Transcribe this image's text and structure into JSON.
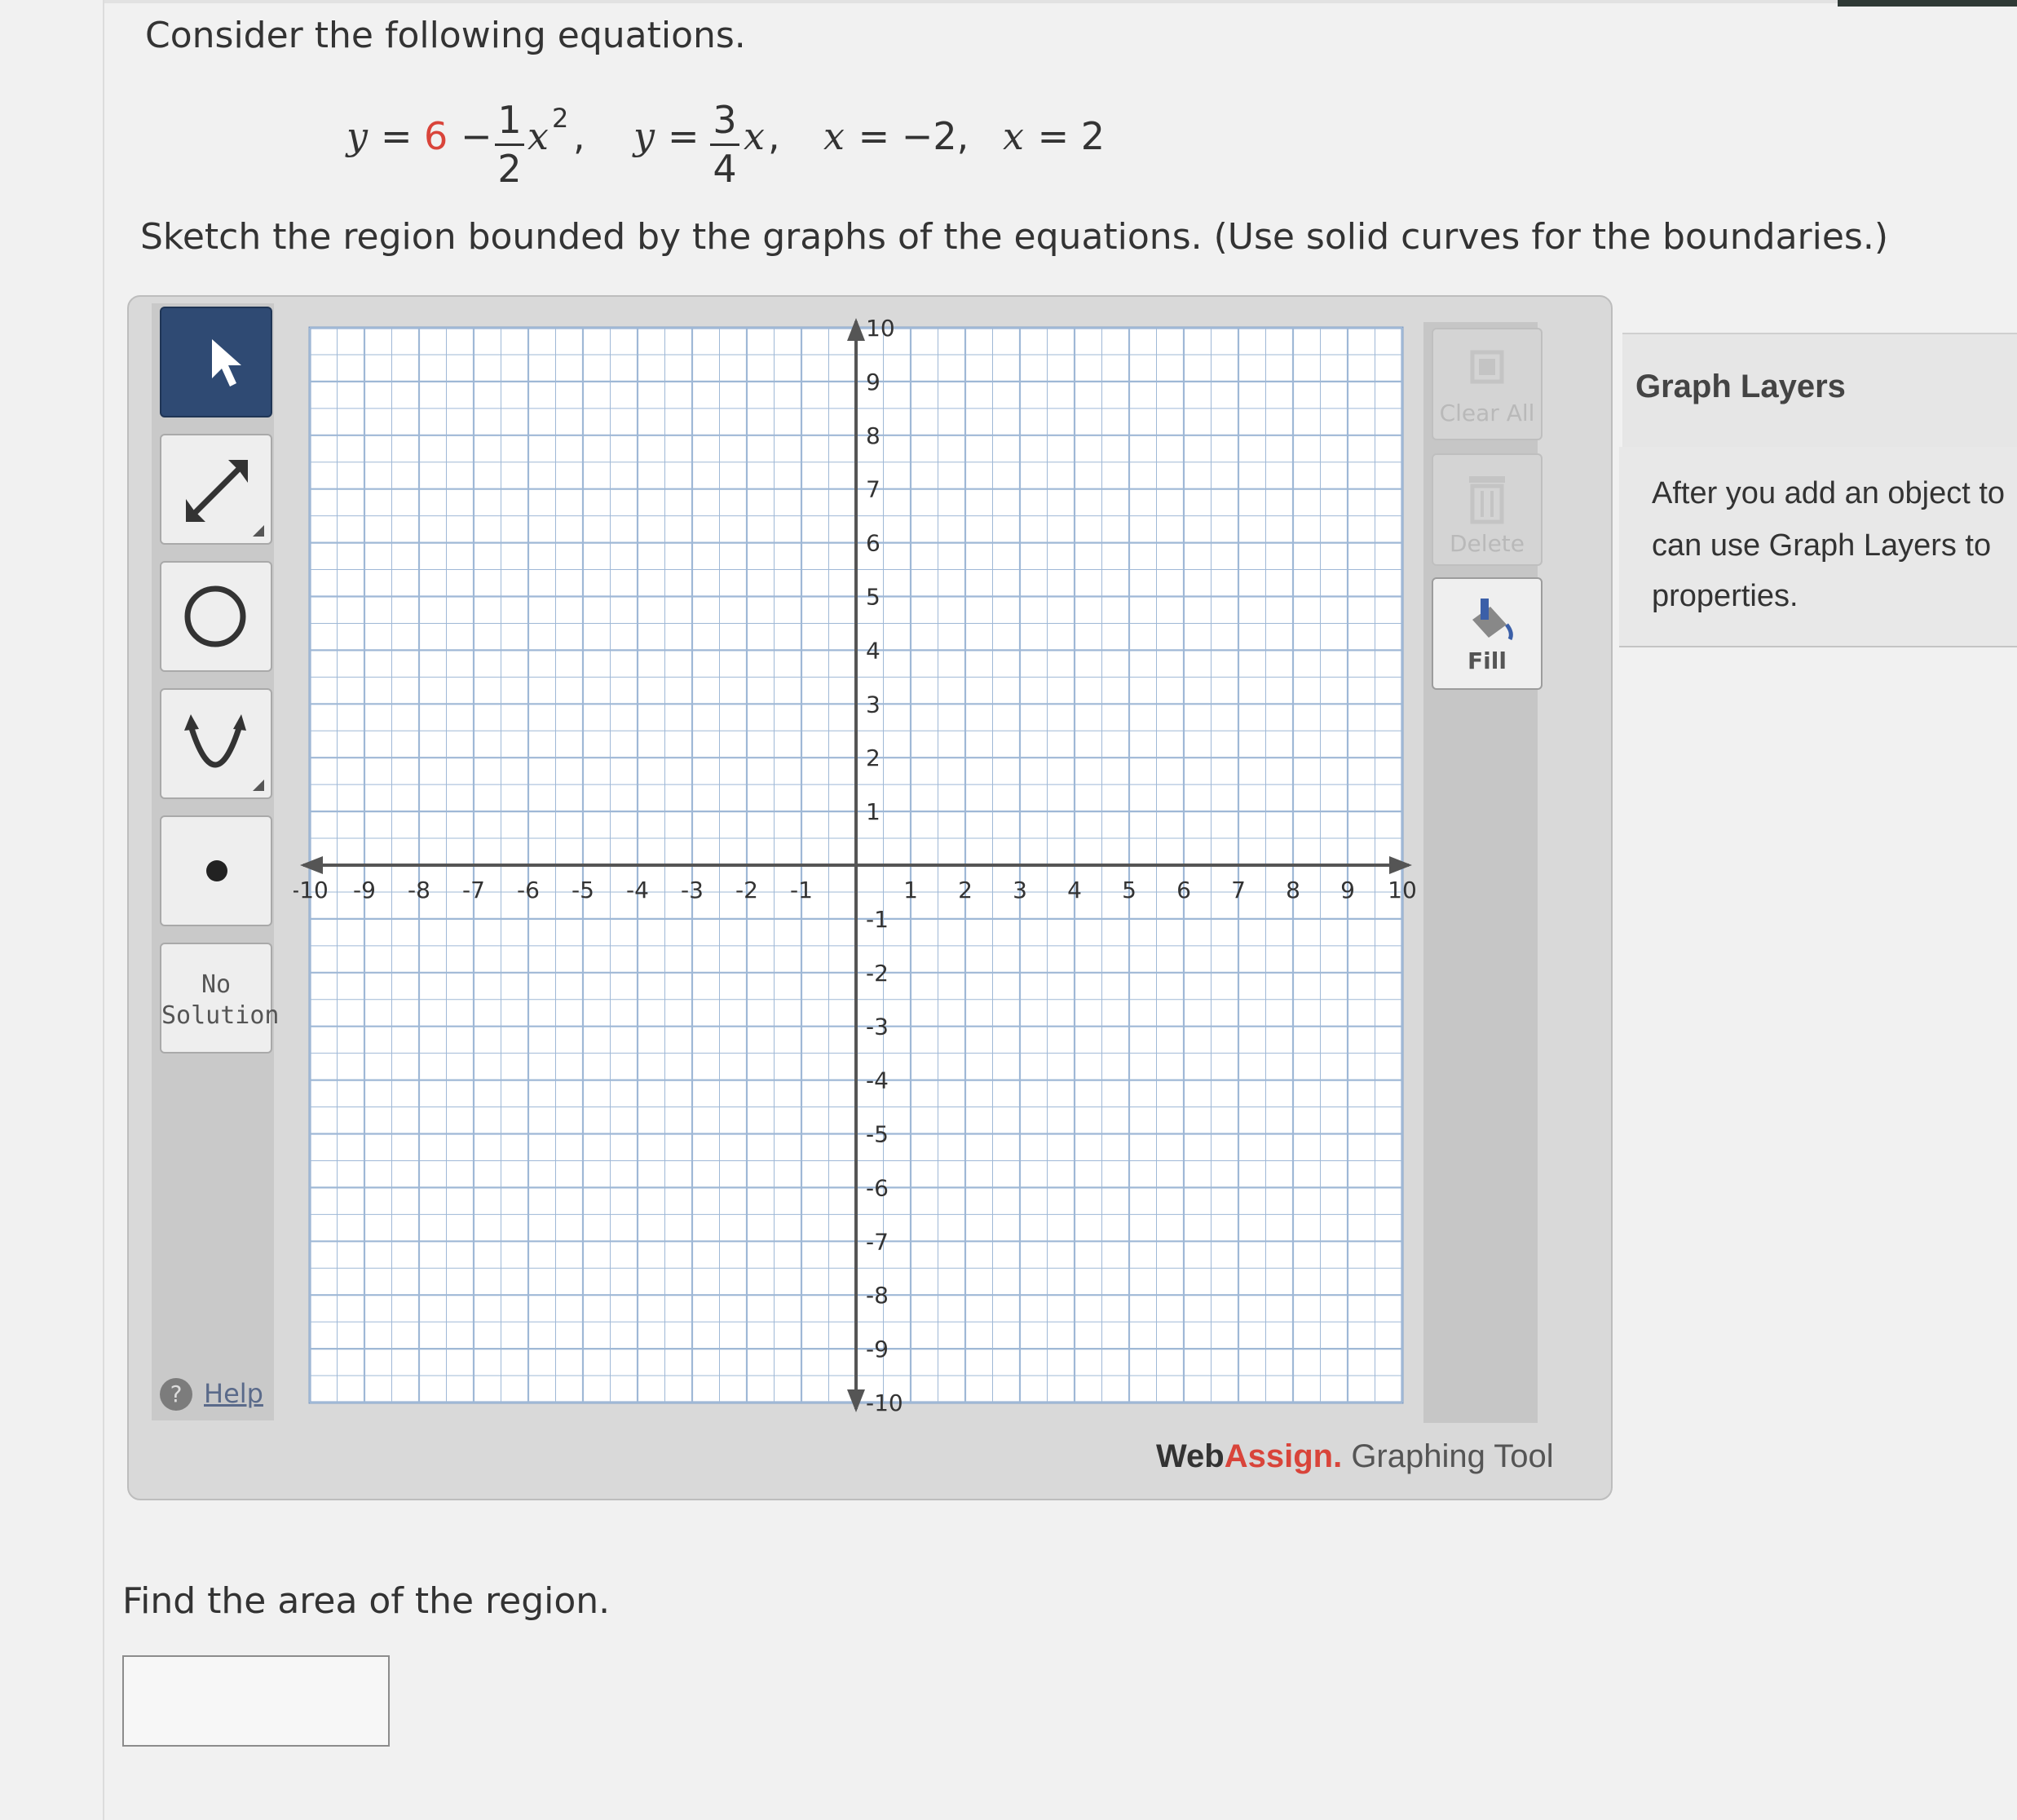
{
  "question": {
    "intro": "Consider the following equations.",
    "instruction": "Sketch the region bounded by the graphs of the equations. (Use solid curves for the boundaries.)",
    "area_prompt": "Find the area of the region."
  },
  "equations": {
    "eq1": {
      "lhs": "y",
      "eq": "=",
      "const": "6",
      "minus": "−",
      "frac_num": "1",
      "frac_den": "2",
      "var": "x",
      "exp": "2",
      "comma": ","
    },
    "eq2": {
      "lhs": "y",
      "eq": "=",
      "frac_num": "3",
      "frac_den": "4",
      "var": "x",
      "comma": ","
    },
    "eq3": {
      "text_var": "x",
      "text_rest": " = −2,"
    },
    "eq4": {
      "text_var": "x",
      "text_rest": " = 2"
    }
  },
  "toolbar": {
    "no_solution_line1": "No",
    "no_solution_line2": "Solution",
    "help_label": "Help",
    "help_icon": "?"
  },
  "actions": {
    "clear_all": "Clear All",
    "delete": "Delete",
    "fill": "Fill"
  },
  "brand": {
    "web": "Web",
    "assign": "Assign.",
    "rest": " Graphing Tool"
  },
  "graph_layers": {
    "title": "Graph Layers",
    "line1": "After you add an object to",
    "line2": "can use Graph Layers to",
    "line3": "properties."
  },
  "colors": {
    "accent": "#d9443a",
    "active_tool": "#2f4a73",
    "grid_line": "#9fb8d6"
  },
  "chart_data": {
    "type": "scatter",
    "xlim": [
      -10,
      10
    ],
    "ylim": [
      -10,
      10
    ],
    "grid": true,
    "x_ticks": [
      "-10",
      "-9",
      "-8",
      "-7",
      "-6",
      "-5",
      "-4",
      "-3",
      "-2",
      "-1",
      "1",
      "2",
      "3",
      "4",
      "5",
      "6",
      "7",
      "8",
      "9",
      "10"
    ],
    "y_ticks": [
      "10",
      "9",
      "8",
      "7",
      "6",
      "5",
      "4",
      "3",
      "2",
      "1",
      "-1",
      "-2",
      "-3",
      "-4",
      "-5",
      "-6",
      "-7",
      "-8",
      "-9",
      "-10"
    ],
    "series": []
  }
}
